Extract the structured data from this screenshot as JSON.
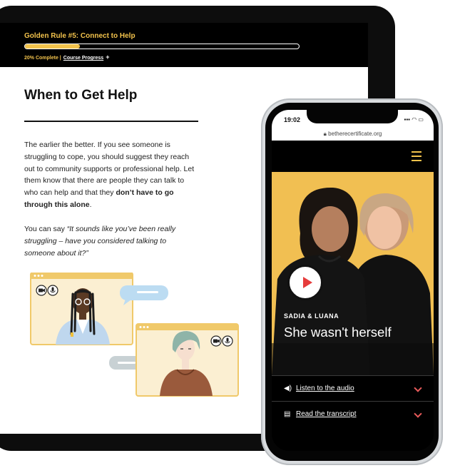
{
  "course": {
    "module_title": "Golden Rule #5: Connect to Help",
    "progress_fraction": 0.2,
    "progress_text": "20% Complete |",
    "progress_link": "Course Progress",
    "progress_plus": "+"
  },
  "lesson": {
    "heading": "When to Get Help",
    "para_lead": "The earlier the better. If you see someone is struggling to cope, you should suggest they reach out to community supports or professional help. Let them know that there are people they can talk to who can help and that they ",
    "para_bold": "don’t have to go through this alone",
    "para_end": ".",
    "quote_lead": "You can say ",
    "quote_italic": "“It sounds like you’ve been really struggling – have you considered talking to someone about it?”"
  },
  "phone": {
    "time": "19:02",
    "url": "betherecertificate.org",
    "hero_names": "SADIA & LUANA",
    "hero_title": "She wasn't herself",
    "accordion": [
      {
        "label": "Listen to the audio",
        "icon": "speaker-icon"
      },
      {
        "label": "Read the transcript",
        "icon": "document-icon"
      }
    ]
  },
  "colors": {
    "accent_yellow": "#f3c34c",
    "play_red": "#e63c3c",
    "chevron_red": "#e65a5a"
  }
}
